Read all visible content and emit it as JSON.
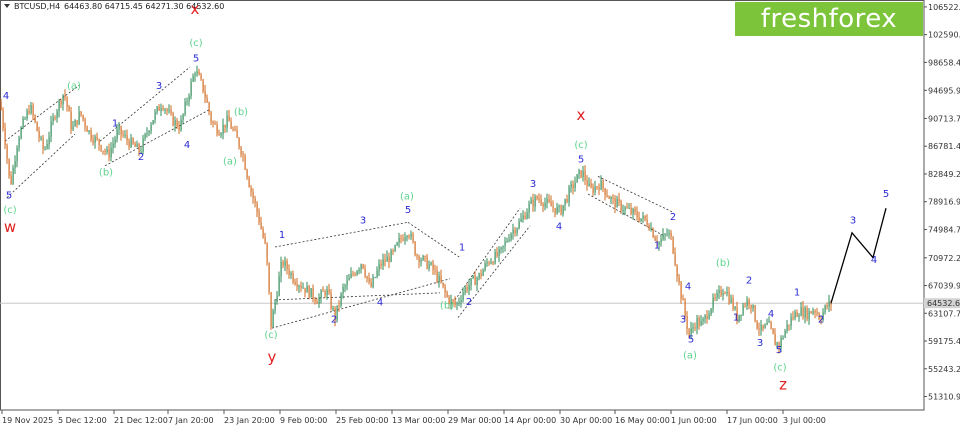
{
  "header": {
    "symbol": "BTCUSD,H4",
    "ohlc": "64463.80 64715.45 64271.30 64532.60"
  },
  "logo": {
    "text": "freshforex"
  },
  "colors": {
    "bull": "#2e8b57",
    "bear": "#d2691e",
    "wave_green": "#5fd38d",
    "wave_blue": "#2b2bd6",
    "wave_red": "#e02020",
    "last_price_bg": "#d3d3d3",
    "forecast": "#000000"
  },
  "chart_data": {
    "type": "candlestick",
    "title": "BTCUSD,H4",
    "ylim": [
      49400,
      107500
    ],
    "y_ticks": [
      "106522.95",
      "102590.70",
      "98658.45",
      "94695.95",
      "90713.70",
      "86781.45",
      "82849.20",
      "78916.95",
      "74984.70",
      "70972.20",
      "67039.95",
      "64532.60",
      "63107.70",
      "59175.45",
      "55243.20",
      "51310.95"
    ],
    "x_ticks": [
      "19 Nov 2025",
      "5 Dec 12:00",
      "21 Dec 12:00",
      "7 Jan 20:00",
      "23 Jan 20:00",
      "9 Feb 00:00",
      "25 Feb 00:00",
      "13 Mar 00:00",
      "29 Mar 00:00",
      "14 Apr 00:00",
      "30 Apr 00:00",
      "16 May 00:00",
      "1 Jun 00:00",
      "17 Jun 00:00",
      "3 Jul 00:00"
    ],
    "last_price": "64532.60",
    "price_path": [
      [
        0,
        93000
      ],
      [
        6,
        86500
      ],
      [
        10,
        81000
      ],
      [
        18,
        88000
      ],
      [
        30,
        92500
      ],
      [
        38,
        88500
      ],
      [
        44,
        86000
      ],
      [
        55,
        91500
      ],
      [
        64,
        94500
      ],
      [
        72,
        89000
      ],
      [
        80,
        91500
      ],
      [
        90,
        88500
      ],
      [
        100,
        87000
      ],
      [
        108,
        85500
      ],
      [
        118,
        89000
      ],
      [
        128,
        87500
      ],
      [
        140,
        86000
      ],
      [
        150,
        90000
      ],
      [
        162,
        93000
      ],
      [
        172,
        90500
      ],
      [
        180,
        89500
      ],
      [
        188,
        94000
      ],
      [
        195,
        97600
      ],
      [
        203,
        95000
      ],
      [
        212,
        90000
      ],
      [
        220,
        89000
      ],
      [
        228,
        90500
      ],
      [
        236,
        88000
      ],
      [
        242,
        86000
      ],
      [
        250,
        81000
      ],
      [
        258,
        77000
      ],
      [
        266,
        72000
      ],
      [
        271,
        61500
      ],
      [
        276,
        65500
      ],
      [
        282,
        70500
      ],
      [
        294,
        68000
      ],
      [
        306,
        66500
      ],
      [
        318,
        65000
      ],
      [
        326,
        66500
      ],
      [
        335,
        62500
      ],
      [
        343,
        66500
      ],
      [
        352,
        68500
      ],
      [
        362,
        70500
      ],
      [
        370,
        66500
      ],
      [
        380,
        70000
      ],
      [
        393,
        71500
      ],
      [
        400,
        73500
      ],
      [
        408,
        75000
      ],
      [
        416,
        71500
      ],
      [
        424,
        70500
      ],
      [
        432,
        69500
      ],
      [
        440,
        67500
      ],
      [
        448,
        65000
      ],
      [
        456,
        64200
      ],
      [
        464,
        66500
      ],
      [
        472,
        67500
      ],
      [
        480,
        68500
      ],
      [
        488,
        70500
      ],
      [
        500,
        71500
      ],
      [
        510,
        74500
      ],
      [
        520,
        76000
      ],
      [
        530,
        78500
      ],
      [
        538,
        79500
      ],
      [
        548,
        78500
      ],
      [
        560,
        77500
      ],
      [
        570,
        80500
      ],
      [
        578,
        82500
      ],
      [
        582,
        83200
      ],
      [
        590,
        80500
      ],
      [
        600,
        81500
      ],
      [
        612,
        79000
      ],
      [
        624,
        78000
      ],
      [
        636,
        77000
      ],
      [
        648,
        76000
      ],
      [
        658,
        73000
      ],
      [
        668,
        74500
      ],
      [
        672,
        73200
      ],
      [
        678,
        68000
      ],
      [
        684,
        63500
      ],
      [
        689,
        60000
      ],
      [
        696,
        62000
      ],
      [
        702,
        61500
      ],
      [
        710,
        64000
      ],
      [
        718,
        65500
      ],
      [
        724,
        66800
      ],
      [
        732,
        64500
      ],
      [
        737,
        62500
      ],
      [
        744,
        64500
      ],
      [
        750,
        65000
      ],
      [
        757,
        61500
      ],
      [
        762,
        60500
      ],
      [
        768,
        61500
      ],
      [
        775,
        59000
      ],
      [
        779,
        58600
      ],
      [
        786,
        61000
      ],
      [
        792,
        62500
      ],
      [
        799,
        63500
      ],
      [
        808,
        63000
      ],
      [
        814,
        63800
      ],
      [
        820,
        62500
      ],
      [
        826,
        64000
      ],
      [
        831,
        64532
      ]
    ],
    "forecast_path": [
      [
        831,
        64532
      ],
      [
        852,
        74500
      ],
      [
        873,
        71000
      ],
      [
        886,
        78000
      ]
    ],
    "wave_labels": [
      {
        "t": "x",
        "x": 195,
        "p": 105500,
        "c": "red",
        "big": true
      },
      {
        "t": "(c)",
        "x": 196,
        "p": 101000,
        "c": "green"
      },
      {
        "t": "5",
        "x": 196,
        "p": 98800,
        "c": "blue"
      },
      {
        "t": "(a)",
        "x": 74,
        "p": 94900,
        "c": "green"
      },
      {
        "t": "4",
        "x": 6,
        "p": 93500,
        "c": "blue"
      },
      {
        "t": "3",
        "x": 159,
        "p": 94900,
        "c": "blue"
      },
      {
        "t": "1",
        "x": 115,
        "p": 89600,
        "c": "blue"
      },
      {
        "t": "(b)",
        "x": 241,
        "p": 91200,
        "c": "green"
      },
      {
        "t": "2",
        "x": 141,
        "p": 84800,
        "c": "blue"
      },
      {
        "t": "4",
        "x": 187,
        "p": 86500,
        "c": "blue"
      },
      {
        "t": "(a)",
        "x": 230,
        "p": 84200,
        "c": "green"
      },
      {
        "t": "(b)",
        "x": 106,
        "p": 82600,
        "c": "green"
      },
      {
        "t": "5",
        "x": 9,
        "p": 79400,
        "c": "blue"
      },
      {
        "t": "(c)",
        "x": 10,
        "p": 77300,
        "c": "green"
      },
      {
        "t": "w",
        "x": 10,
        "p": 74600,
        "c": "red",
        "big": true
      },
      {
        "t": "(a)",
        "x": 407,
        "p": 79200,
        "c": "green"
      },
      {
        "t": "5",
        "x": 408,
        "p": 77300,
        "c": "blue"
      },
      {
        "t": "3",
        "x": 363,
        "p": 75800,
        "c": "blue"
      },
      {
        "t": "1",
        "x": 282,
        "p": 73800,
        "c": "blue"
      },
      {
        "t": "4",
        "x": 380,
        "p": 64200,
        "c": "blue"
      },
      {
        "t": "2",
        "x": 334,
        "p": 61800,
        "c": "blue"
      },
      {
        "t": "(c)",
        "x": 271,
        "p": 59600,
        "c": "green"
      },
      {
        "t": "y",
        "x": 272,
        "p": 56200,
        "c": "red",
        "big": true
      },
      {
        "t": "(b)",
        "x": 447,
        "p": 63800,
        "c": "green"
      },
      {
        "t": "2",
        "x": 469,
        "p": 64300,
        "c": "blue"
      },
      {
        "t": "1",
        "x": 462,
        "p": 72000,
        "c": "blue"
      },
      {
        "t": "3",
        "x": 533,
        "p": 81000,
        "c": "blue"
      },
      {
        "t": "4",
        "x": 559,
        "p": 75000,
        "c": "blue"
      },
      {
        "t": "x",
        "x": 581,
        "p": 90500,
        "c": "red",
        "big": true
      },
      {
        "t": "(c)",
        "x": 581,
        "p": 86500,
        "c": "green"
      },
      {
        "t": "5",
        "x": 581,
        "p": 84500,
        "c": "blue"
      },
      {
        "t": "2",
        "x": 673,
        "p": 76300,
        "c": "blue"
      },
      {
        "t": "1",
        "x": 657,
        "p": 72300,
        "c": "blue"
      },
      {
        "t": "4",
        "x": 688,
        "p": 66500,
        "c": "blue"
      },
      {
        "t": "3",
        "x": 683,
        "p": 61800,
        "c": "blue"
      },
      {
        "t": "5",
        "x": 691,
        "p": 59000,
        "c": "blue"
      },
      {
        "t": "(a)",
        "x": 690,
        "p": 56700,
        "c": "green"
      },
      {
        "t": "(b)",
        "x": 723,
        "p": 69800,
        "c": "green"
      },
      {
        "t": "2",
        "x": 749,
        "p": 67300,
        "c": "blue"
      },
      {
        "t": "1",
        "x": 736,
        "p": 62100,
        "c": "blue"
      },
      {
        "t": "4",
        "x": 771,
        "p": 62600,
        "c": "blue"
      },
      {
        "t": "3",
        "x": 760,
        "p": 58500,
        "c": "blue"
      },
      {
        "t": "5",
        "x": 779,
        "p": 57500,
        "c": "blue"
      },
      {
        "t": "(c)",
        "x": 780,
        "p": 55000,
        "c": "green"
      },
      {
        "t": "z",
        "x": 783,
        "p": 52300,
        "c": "red",
        "big": true
      },
      {
        "t": "1",
        "x": 797,
        "p": 65600,
        "c": "blue"
      },
      {
        "t": "2",
        "x": 821,
        "p": 61800,
        "c": "blue"
      },
      {
        "t": "3",
        "x": 853,
        "p": 75800,
        "c": "blue"
      },
      {
        "t": "4",
        "x": 874,
        "p": 70200,
        "c": "blue"
      },
      {
        "t": "5",
        "x": 886,
        "p": 79600,
        "c": "blue"
      }
    ],
    "channels": [
      [
        [
          5,
          87500
        ],
        [
          80,
          95500
        ]
      ],
      [
        [
          7,
          79500
        ],
        [
          75,
          88500
        ]
      ],
      [
        [
          100,
          87500
        ],
        [
          190,
          98000
        ]
      ],
      [
        [
          105,
          84000
        ],
        [
          210,
          92000
        ]
      ],
      [
        [
          275,
          72500
        ],
        [
          408,
          76000
        ]
      ],
      [
        [
          272,
          61000
        ],
        [
          450,
          68000
        ]
      ],
      [
        [
          275,
          65000
        ],
        [
          440,
          66000
        ]
      ],
      [
        [
          408,
          76000
        ],
        [
          460,
          71000
        ]
      ],
      [
        [
          455,
          65000
        ],
        [
          520,
          78000
        ]
      ],
      [
        [
          458,
          62500
        ],
        [
          530,
          75500
        ]
      ],
      [
        [
          598,
          82500
        ],
        [
          672,
          77500
        ]
      ],
      [
        [
          588,
          80000
        ],
        [
          665,
          74000
        ]
      ]
    ]
  }
}
